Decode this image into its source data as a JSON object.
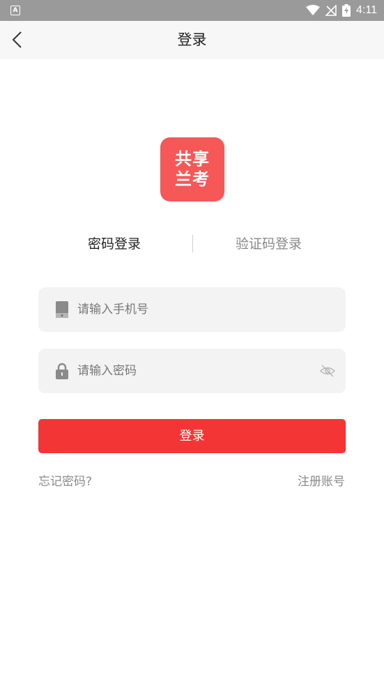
{
  "status_bar": {
    "app_icon_letter": "A",
    "time": "4:11"
  },
  "header": {
    "title": "登录"
  },
  "logo": {
    "line1": "共享",
    "line2": "兰考"
  },
  "tabs": [
    {
      "label": "密码登录",
      "active": true
    },
    {
      "label": "验证码登录",
      "active": false
    }
  ],
  "form": {
    "phone_placeholder": "请输入手机号",
    "password_placeholder": "请输入密码",
    "submit_label": "登录"
  },
  "links": {
    "forgot_password": "忘记密码?",
    "register": "注册账号"
  },
  "colors": {
    "accent": "#f33535",
    "logo_bg": "#f65757",
    "status_bar_bg": "#9a9a9a",
    "header_bg": "#f7f7f7"
  },
  "icons": {
    "back": "chevron-left-icon",
    "phone": "phone-icon",
    "lock": "lock-icon",
    "eye": "eye-off-icon"
  }
}
